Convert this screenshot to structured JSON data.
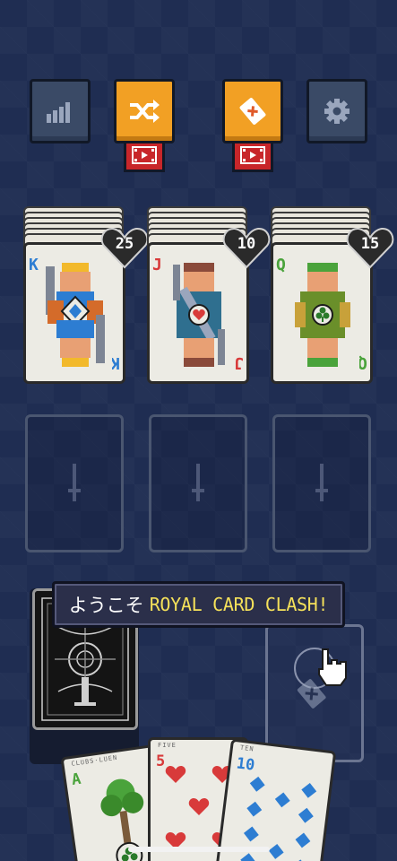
{
  "toolbar": {
    "stats_icon": "bar-chart-icon",
    "shuffle_icon": "shuffle-icon",
    "discard_icon": "card-x-icon",
    "settings_icon": "gear-icon",
    "ad_icon": "video-icon"
  },
  "colors": {
    "background": "#1f2d52",
    "button_gray": "#3a4a66",
    "button_orange": "#f2a024",
    "ad_red": "#c8262a",
    "banner_yellow": "#f5e15a"
  },
  "enemies": [
    {
      "rank": "K",
      "suit": "diamond",
      "hp": "25",
      "rank_color": "#2d7dd2"
    },
    {
      "rank": "J",
      "suit": "heart",
      "hp": "10",
      "rank_color": "#d83a3a"
    },
    {
      "rank": "Q",
      "suit": "club",
      "hp": "15",
      "rank_color": "#4aa33b"
    }
  ],
  "slots": [
    {
      "icon": "sword-icon"
    },
    {
      "icon": "sword-icon"
    },
    {
      "icon": "sword-icon"
    }
  ],
  "banner": {
    "greeting": "ようこそ",
    "title": "ROYAL CARD CLASH!"
  },
  "hand": [
    {
      "rank": "A",
      "label": "CLUBS·LUEN",
      "suit": "club",
      "rank_color": "#4aa33b"
    },
    {
      "rank": "5",
      "label": "FIVE",
      "suit": "heart",
      "rank_color": "#d83a3a"
    },
    {
      "rank": "10",
      "label": "TEN",
      "suit": "diamond",
      "rank_color": "#2d7dd2"
    }
  ]
}
